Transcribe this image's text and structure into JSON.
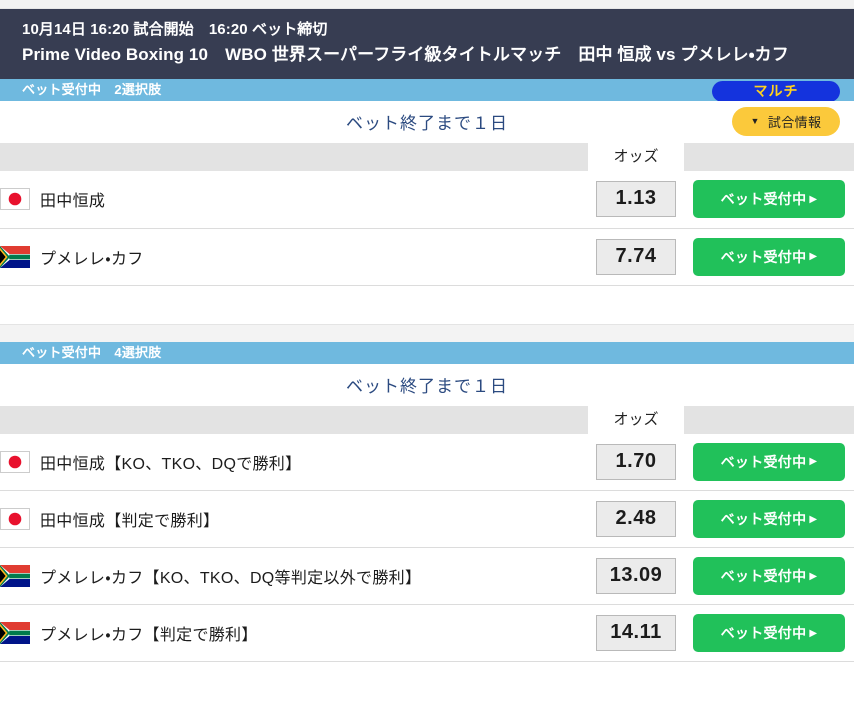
{
  "header": {
    "line1": "10月14日 16:20 試合開始　16:20 ベット締切",
    "line2": "Prime Video Boxing 10　WBO 世界スーパーフライ級タイトルマッチ　田中 恒成 vs プメレレ・カフ"
  },
  "colors": {
    "header_bg": "#373d52",
    "status_bar_bg": "#6fb9df",
    "multi_badge_bg": "#1433dd",
    "multi_badge_text": "#ffd21e",
    "info_button_bg": "#fbc93b",
    "bet_button_bg": "#21c15a",
    "countdown_text": "#2b4a80",
    "odds_box_bg": "#ebebeb",
    "table_head_bg": "#e3e3e3"
  },
  "info_button": {
    "label": "試合情報",
    "caret": "▼"
  },
  "sections": [
    {
      "status_label": "ベット受付中　2選択肢",
      "multi_badge": "マルチ",
      "countdown": "ベット終了まで１日",
      "odds_column_header": "オッズ",
      "rows": [
        {
          "flag": "jp-flag-icon",
          "name": "田中恒成",
          "odds": "1.13",
          "button_label": "ベット受付中",
          "button_arrow": "▶"
        },
        {
          "flag": "za-flag-icon",
          "name": "プメレレ・カフ",
          "odds": "7.74",
          "button_label": "ベット受付中",
          "button_arrow": "▶"
        }
      ]
    },
    {
      "status_label": "ベット受付中　4選択肢",
      "multi_badge": "",
      "countdown": "ベット終了まで１日",
      "odds_column_header": "オッズ",
      "rows": [
        {
          "flag": "jp-flag-icon",
          "name": "田中恒成【KO、TKO、DQで勝利】",
          "odds": "1.70",
          "button_label": "ベット受付中",
          "button_arrow": "▶"
        },
        {
          "flag": "jp-flag-icon",
          "name": "田中恒成【判定で勝利】",
          "odds": "2.48",
          "button_label": "ベット受付中",
          "button_arrow": "▶"
        },
        {
          "flag": "za-flag-icon",
          "name": "プメレレ・カフ【KO、TKO、DQ等判定以外で勝利】",
          "odds": "13.09",
          "button_label": "ベット受付中",
          "button_arrow": "▶"
        },
        {
          "flag": "za-flag-icon",
          "name": "プメレレ・カフ【判定で勝利】",
          "odds": "14.11",
          "button_label": "ベット受付中",
          "button_arrow": "▶"
        }
      ]
    }
  ]
}
